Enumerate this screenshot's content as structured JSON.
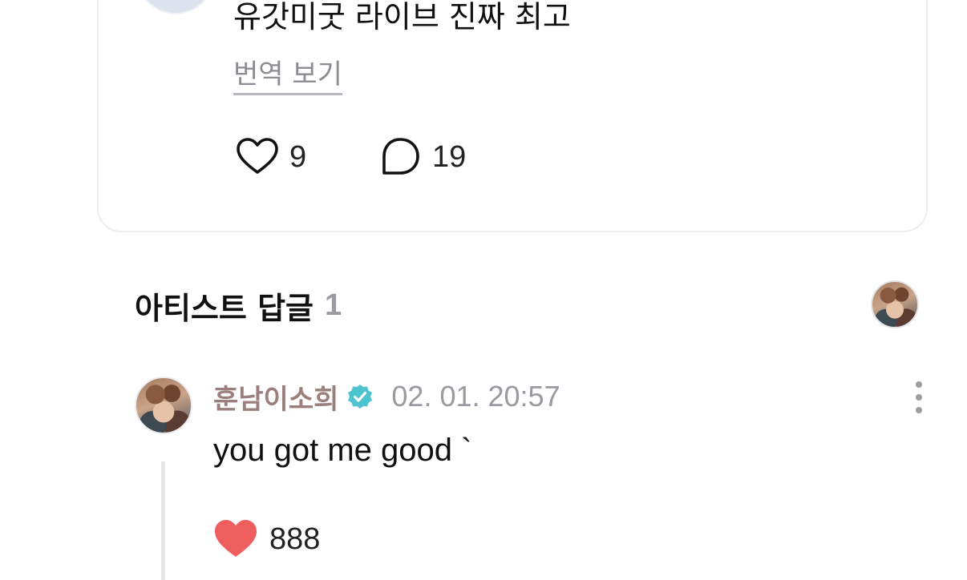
{
  "post": {
    "text": "유갓미굿 라이브 진짜 최고",
    "translate_label": "번역 보기",
    "like_count": "9",
    "comment_count": "19",
    "icons": {
      "like": "heart-outline-icon",
      "comment": "speech-bubble-icon"
    }
  },
  "artist_replies": {
    "title": "아티스트 답글",
    "count": "1"
  },
  "reply": {
    "author": "훈남이소희",
    "verified_icon": "verified-badge-icon",
    "timestamp": "02. 01. 20:57",
    "text": "you got me good `",
    "like_count": "888",
    "liked": true
  },
  "colors": {
    "author_name": "#9b7f7c",
    "verified": "#4cc3cf",
    "liked_heart": "#ef5e5e",
    "muted_text": "#9a9aa0",
    "card_border": "#ececf1"
  }
}
